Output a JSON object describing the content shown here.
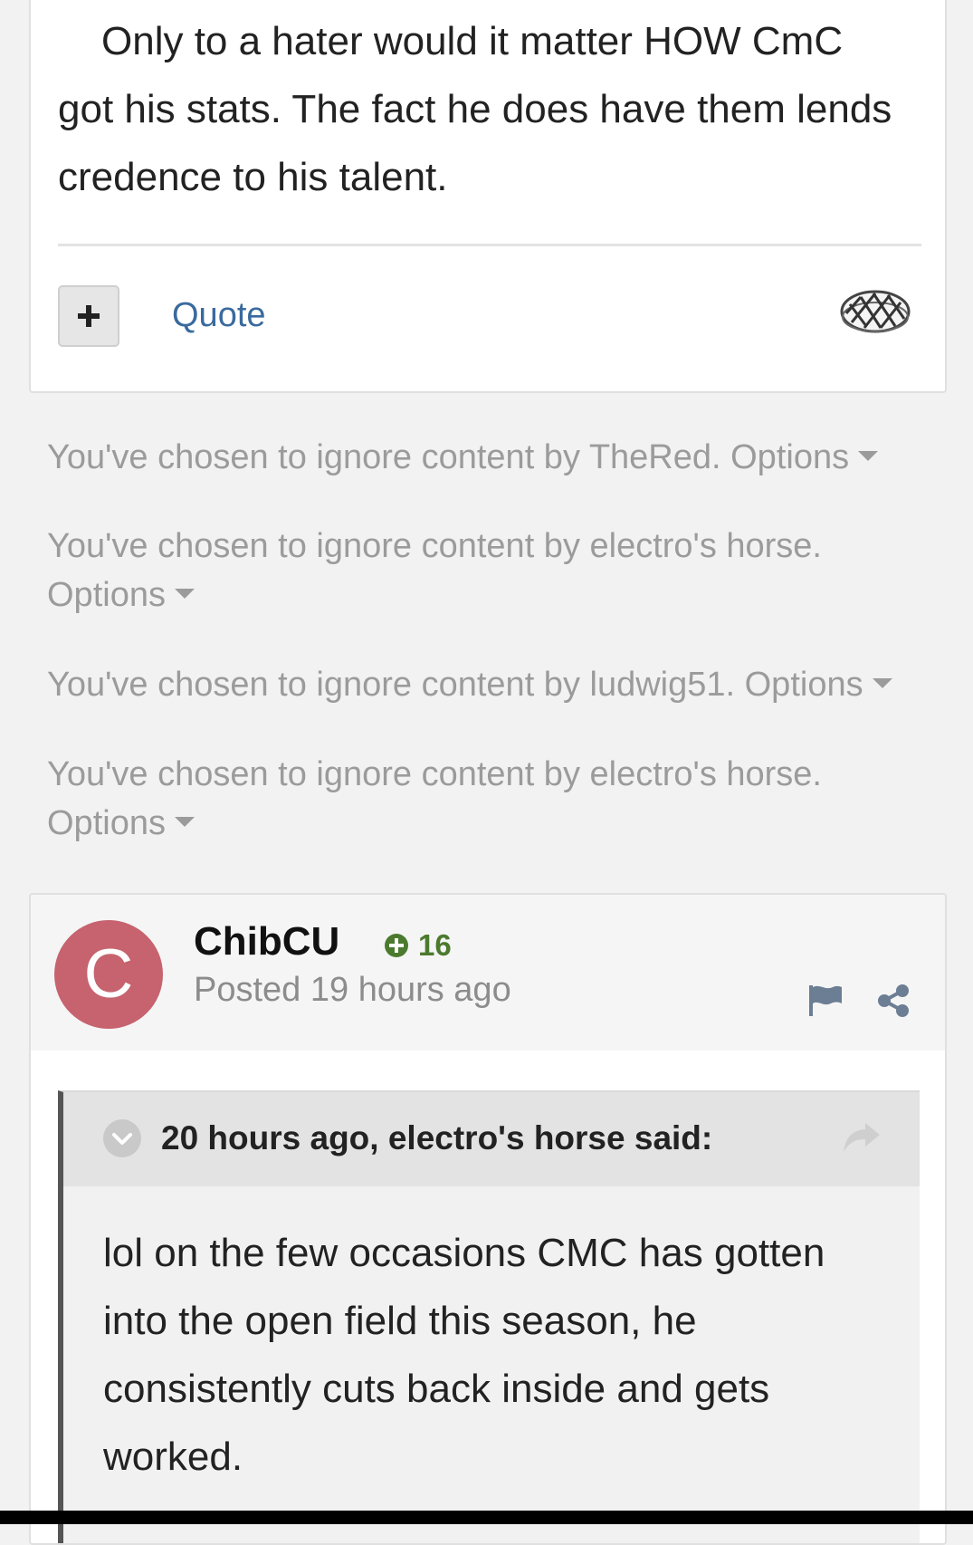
{
  "post_top": {
    "body_text": "Only to a hater would it matter HOW CmC got his stats. The fact he does have them lends credence to his talent.",
    "quote_label": "Quote",
    "reaction_icon": "pie-icon"
  },
  "ignored": [
    {
      "text": "You've chosen to ignore content by TheRed.",
      "options": "Options"
    },
    {
      "text": "You've chosen to ignore content by electro's horse.",
      "options": "Options"
    },
    {
      "text": "You've chosen to ignore content by ludwig51.",
      "options": "Options"
    },
    {
      "text": "You've chosen to ignore content by electro's horse.",
      "options": "Options"
    }
  ],
  "post_bottom": {
    "avatar_letter": "C",
    "avatar_color": "#c6636e",
    "author": "ChibCU",
    "reputation": "16",
    "posted": "Posted 19 hours ago",
    "quote": {
      "attribution": "20 hours ago, electro's horse said:",
      "text": "lol on the few occasions CMC has gotten into the open field this season, he consistently cuts back inside and gets worked."
    }
  },
  "colors": {
    "link": "#3a6a9e",
    "muted": "#9b9b9b",
    "reputation_green": "#4b7a2e"
  }
}
